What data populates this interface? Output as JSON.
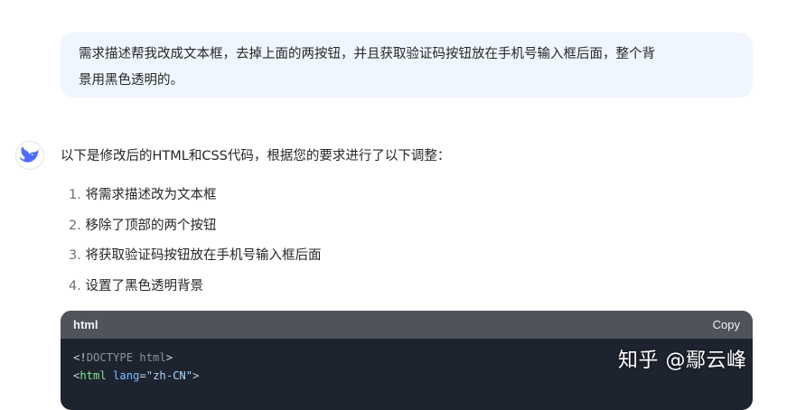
{
  "user_message": {
    "line1": "需求描述帮我改成文本框，去掉上面的两按钮，并且获取验证码按钮放在手机号输入框后面，整个背",
    "line2": "景用黑色透明的。"
  },
  "assistant": {
    "avatar_icon": "whale-logo-icon",
    "intro": "以下是修改后的HTML和CSS代码，根据您的要求进行了以下调整：",
    "steps": [
      {
        "num": "1.",
        "text": "将需求描述改为文本框"
      },
      {
        "num": "2.",
        "text": "移除了顶部的两个按钮"
      },
      {
        "num": "3.",
        "text": "将获取验证码按钮放在手机号输入框后面"
      },
      {
        "num": "4.",
        "text": "设置了黑色透明背景"
      }
    ]
  },
  "code_block": {
    "language": "html",
    "copy_label": "Copy",
    "line1": {
      "open": "<!",
      "doctype": "DOCTYPE html",
      "close": ">"
    },
    "line2": {
      "open": "<",
      "tag": "html",
      "attr": "lang",
      "eq": "=",
      "value": "\"zh-CN\"",
      "close": ">"
    }
  },
  "watermark": "知乎 @鄢云峰",
  "colors": {
    "user_bubble_bg": "#eff6ff",
    "code_header_bg": "#50535c",
    "code_body_bg": "#1e2330",
    "accent_blue": "#4d6bfe"
  }
}
